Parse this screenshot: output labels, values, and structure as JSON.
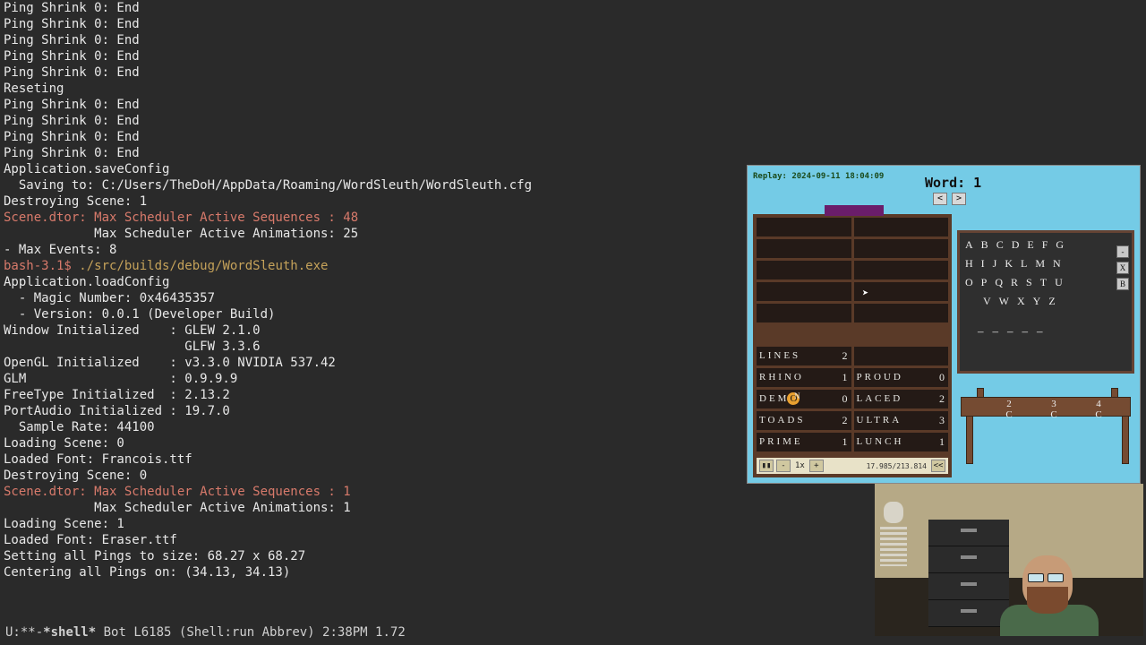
{
  "terminal": {
    "lines": [
      {
        "t": "Ping Shrink 0: End"
      },
      {
        "t": "Ping Shrink 0: End"
      },
      {
        "t": "Ping Shrink 0: End"
      },
      {
        "t": "Ping Shrink 0: End"
      },
      {
        "t": "Ping Shrink 0: End"
      },
      {
        "t": "Reseting"
      },
      {
        "t": "Ping Shrink 0: End"
      },
      {
        "t": "Ping Shrink 0: End"
      },
      {
        "t": "Ping Shrink 0: End"
      },
      {
        "t": "Ping Shrink 0: End"
      },
      {
        "t": "Application.saveConfig"
      },
      {
        "t": "  Saving to: C:/Users/TheDoH/AppData/Roaming/WordSleuth/WordSleuth.cfg"
      },
      {
        "t": "Destroying Scene: 1"
      },
      {
        "t": "Scene.dtor: Max Scheduler Active Sequences : 48",
        "cls": "red"
      },
      {
        "t": "            Max Scheduler Active Animations: 25"
      },
      {
        "t": "- Max Events: 8"
      },
      {
        "prompt": "bash-3.1$ ",
        "cmd": "./src/builds/debug/WordSleuth.exe"
      },
      {
        "t": "Application.loadConfig"
      },
      {
        "t": "  - Magic Number: 0x46435357"
      },
      {
        "t": "  - Version: 0.0.1 (Developer Build)"
      },
      {
        "t": "Window Initialized    : GLEW 2.1.0"
      },
      {
        "t": "                        GLFW 3.3.6"
      },
      {
        "t": "OpenGL Initialized    : v3.3.0 NVIDIA 537.42"
      },
      {
        "t": "GLM                   : 0.9.9.9"
      },
      {
        "t": "FreeType Initialized  : 2.13.2"
      },
      {
        "t": "PortAudio Initialized : 19.7.0"
      },
      {
        "t": "  Sample Rate: 44100"
      },
      {
        "t": "Loading Scene: 0"
      },
      {
        "t": "Loaded Font: Francois.ttf"
      },
      {
        "t": "Destroying Scene: 0"
      },
      {
        "t": "Scene.dtor: Max Scheduler Active Sequences : 1",
        "cls": "red"
      },
      {
        "t": "            Max Scheduler Active Animations: 1"
      },
      {
        "t": "Loading Scene: 1"
      },
      {
        "t": "Loaded Font: Eraser.ttf"
      },
      {
        "t": "Setting all Pings to size: 68.27 x 68.27"
      },
      {
        "t": "Centering all Pings on: (34.13, 34.13)"
      }
    ]
  },
  "status": {
    "left": "U:**-",
    "buffer": "*shell*",
    "mid": "      Bot L6185  (Shell:run Abbrev) 2:38PM 1.72"
  },
  "game": {
    "replay": "Replay: 2024-09-11 18:04:09",
    "word_label": "Word: 1",
    "prev": "<",
    "next": ">",
    "words_left": [
      {
        "w": "LINES",
        "s": "2"
      },
      {
        "w": "RHINO",
        "s": "1"
      },
      {
        "w": "DEMO",
        "s": "0",
        "hl": "O",
        "sup": "N"
      },
      {
        "w": "TOADS",
        "s": "2"
      },
      {
        "w": "PRIME",
        "s": "1"
      }
    ],
    "words_right": [
      {
        "w": "",
        "s": ""
      },
      {
        "w": "PROUD",
        "s": "0"
      },
      {
        "w": "LACED",
        "s": "2"
      },
      {
        "w": "ULTRA",
        "s": "3"
      },
      {
        "w": "LUNCH",
        "s": "1"
      }
    ],
    "playback": {
      "pause": "▮▮",
      "minus": "-",
      "speed": "1x",
      "plus": "+",
      "time": "17.985/213.814",
      "rewind": "<<"
    },
    "alphabet": [
      [
        "A",
        "B",
        "C",
        "D",
        "E",
        "F",
        "G"
      ],
      [
        "H",
        "I",
        "J",
        "K",
        "L",
        "M",
        "N"
      ],
      [
        "O",
        "P",
        "Q",
        "R",
        "S",
        "T",
        "U"
      ],
      [
        "V",
        "W",
        "X",
        "Y",
        "Z"
      ]
    ],
    "dashes": [
      "–",
      "–",
      "–",
      "–",
      "–"
    ],
    "side_btns": [
      "‑",
      "X",
      "B"
    ],
    "desk": {
      "n": [
        "2",
        "3",
        "4"
      ],
      "c": [
        "C",
        "C",
        "C"
      ]
    }
  }
}
